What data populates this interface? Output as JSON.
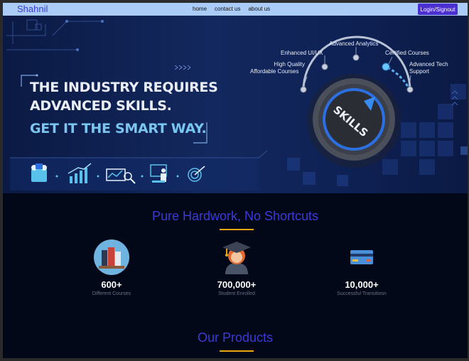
{
  "nav": {
    "brand": "Shahnil",
    "links": [
      "home",
      "contact us",
      "about us"
    ],
    "login_label": "Login/Signout"
  },
  "hero": {
    "headline_1": "THE INDUSTRY REQUIRES",
    "headline_2": "ADVANCED SKILLS.",
    "headline_3": "GET IT THE SMART WAY.",
    "dial_text": "SKILLS",
    "skill_labels": {
      "advanced_analytics": "Advanced Analytics",
      "enhanced_ui": "Enhanced UI/UX",
      "high_quality": "High Quality",
      "affordable_courses": "Affordable Courses",
      "certified_courses": "Certified Courses",
      "advanced_tech_1": "Advanced Tech",
      "advanced_tech_2": "Support"
    },
    "accent_color": "#79c6f0"
  },
  "stats_section": {
    "title": "Pure Hardwork, No Shortcuts",
    "stats": [
      {
        "value": "600+",
        "label": "Different Courses",
        "icon": "books-icon"
      },
      {
        "value": "700,000+",
        "label": "Student Enrolled",
        "icon": "graduate-icon"
      },
      {
        "value": "10,000+",
        "label": "Successful Transitiosn",
        "icon": "credit-card-icon"
      }
    ]
  },
  "products_section": {
    "title": "Our Products"
  },
  "colors": {
    "nav_bg": "#aaccf6",
    "brand": "#3a3ad9",
    "login_bg": "#4b2fd0",
    "title": "#3b3ad6",
    "underline": "#e9a812",
    "page_bg": "#030819"
  }
}
